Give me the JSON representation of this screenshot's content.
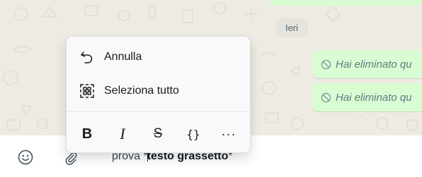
{
  "chat": {
    "date_chip": "Ieri",
    "deleted_messages": [
      {
        "text": "Hai eliminato qu",
        "icon": "deleted-message-icon"
      },
      {
        "text": "Hai eliminato qu",
        "icon": "deleted-message-icon"
      }
    ]
  },
  "context_menu": {
    "items": [
      {
        "label": "Annulla",
        "icon": "undo-icon"
      },
      {
        "label": "Seleziona tutto",
        "icon": "select-all-icon"
      }
    ],
    "format_buttons": [
      {
        "label": "B",
        "name": "bold"
      },
      {
        "label": "I",
        "name": "italic"
      },
      {
        "label": "S",
        "name": "strikethrough"
      },
      {
        "label": "{}",
        "name": "monospace"
      },
      {
        "label": "···",
        "name": "more"
      }
    ]
  },
  "composer": {
    "text_before": "prova *",
    "text_bold": "testo grassetto",
    "text_after": "*"
  },
  "icons": {
    "emoji": "emoji-icon",
    "attach": "paperclip-icon"
  },
  "colors": {
    "outgoing_bubble": "#d9fdd3",
    "chat_background": "#eeebe3",
    "muted_text": "#667781"
  }
}
